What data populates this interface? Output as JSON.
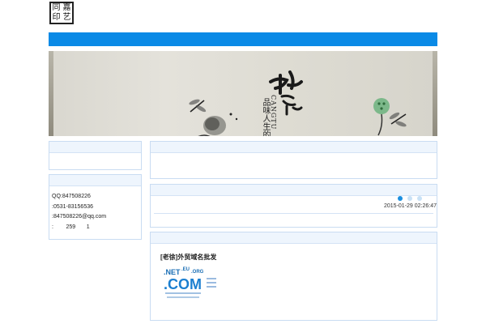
{
  "logo": {
    "chars": [
      "同",
      "嘉",
      "印",
      "艺"
    ]
  },
  "banner": {
    "slogan_cn": "品味人生的",
    "slogan_en": "CANGTU"
  },
  "sidebar": {
    "contact": {
      "qq": "QQ:847508226",
      "phone": ":0531-83156536",
      "email": ":847508226@qq.com",
      "stats": ":        259       1"
    }
  },
  "main": {
    "slider": {
      "dot_count": 3,
      "active_index": 0
    },
    "news": {
      "timestamp": "2015-01-29 02:26:47"
    },
    "ad": {
      "title": "[老徐]外贸域名批发",
      "image_text": {
        "net": ".NET",
        "eu": ".EU",
        "org": ".ORG",
        "com": ".COM"
      }
    }
  },
  "colors": {
    "topbar": "#0a8ae6",
    "panel_border": "#c9dcf2",
    "panel_header": "#eef5fd",
    "dot_active": "#1a8fe0"
  }
}
